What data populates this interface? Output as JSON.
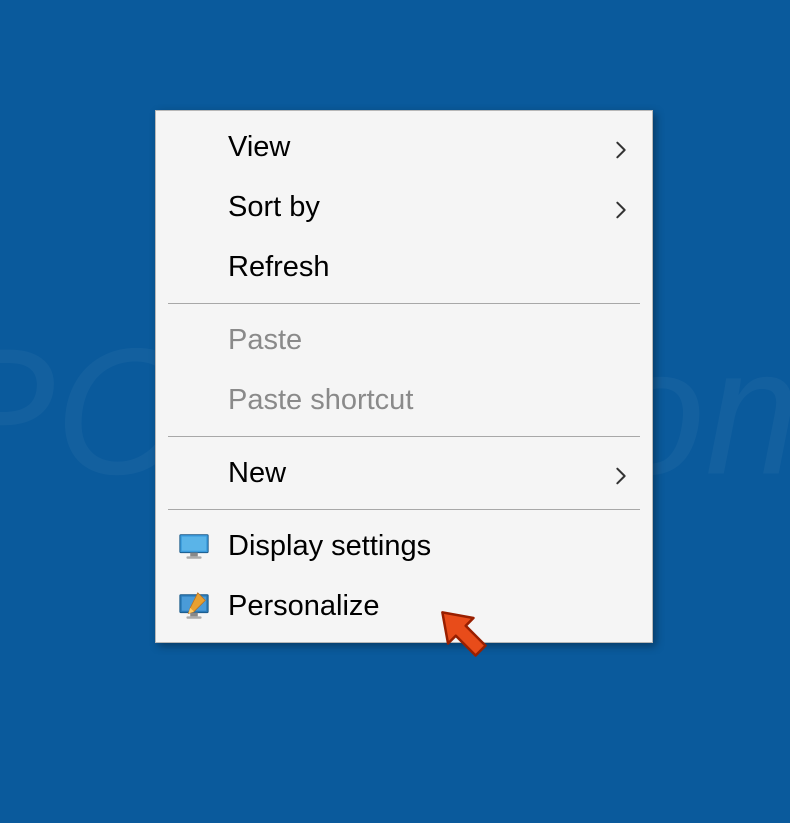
{
  "menu": {
    "items": [
      {
        "label": "View",
        "has_submenu": true,
        "disabled": false,
        "icon": null
      },
      {
        "label": "Sort by",
        "has_submenu": true,
        "disabled": false,
        "icon": null
      },
      {
        "label": "Refresh",
        "has_submenu": false,
        "disabled": false,
        "icon": null
      },
      {
        "type": "separator"
      },
      {
        "label": "Paste",
        "has_submenu": false,
        "disabled": true,
        "icon": null
      },
      {
        "label": "Paste shortcut",
        "has_submenu": false,
        "disabled": true,
        "icon": null
      },
      {
        "type": "separator"
      },
      {
        "label": "New",
        "has_submenu": true,
        "disabled": false,
        "icon": null
      },
      {
        "type": "separator"
      },
      {
        "label": "Display settings",
        "has_submenu": false,
        "disabled": false,
        "icon": "monitor-icon"
      },
      {
        "label": "Personalize",
        "has_submenu": false,
        "disabled": false,
        "icon": "personalize-icon"
      }
    ]
  },
  "watermark_text": "PCrisk.com"
}
